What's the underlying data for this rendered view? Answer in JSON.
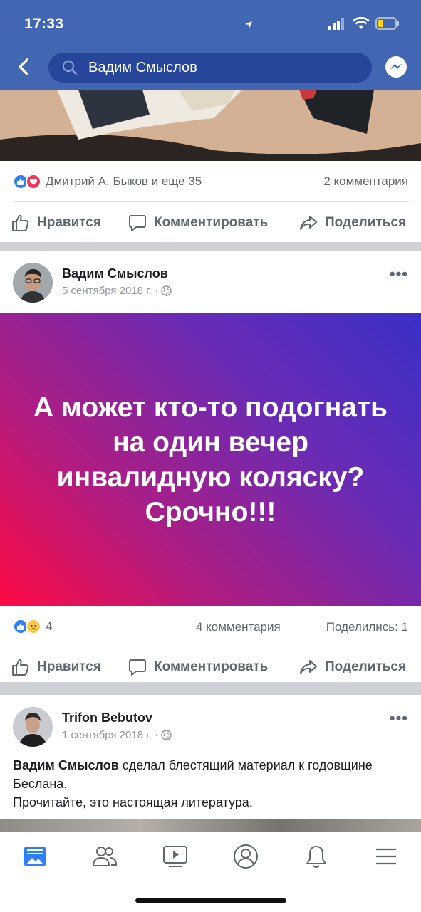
{
  "status": {
    "time": "17:33"
  },
  "search": {
    "query": "Вадим Смыслов"
  },
  "post1": {
    "reactions_text": "Дмитрий А. Быков и еще 35",
    "comments": "2 комментария",
    "actions": {
      "like": "Нравится",
      "comment": "Комментировать",
      "share": "Поделиться"
    }
  },
  "post2": {
    "author": "Вадим Смыслов",
    "date": "5 сентября 2018 г. ·",
    "banner_text": "А может кто-то подогнать на один вечер инвалидную коляску? Срочно!!!",
    "reaction_count": "4",
    "comments": "4 комментария",
    "shares": "Поделились: 1",
    "actions": {
      "like": "Нравится",
      "comment": "Комментировать",
      "share": "Поделиться"
    }
  },
  "post3": {
    "author": "Trifon Bebutov",
    "date": "1 сентября 2018 г. ·",
    "mention": "Вадим Смыслов",
    "text_after_mention": " сделал блестящий материал к годовщине Беслана.",
    "line2": "Прочитайте, это настоящая литература."
  },
  "tabs": [
    "news-feed-icon",
    "friends-icon",
    "watch-icon",
    "profile-icon",
    "notifications-icon",
    "menu-icon"
  ],
  "colors": {
    "header": "#4267b2",
    "like": "#2e7ef7",
    "love": "#f0345a"
  }
}
